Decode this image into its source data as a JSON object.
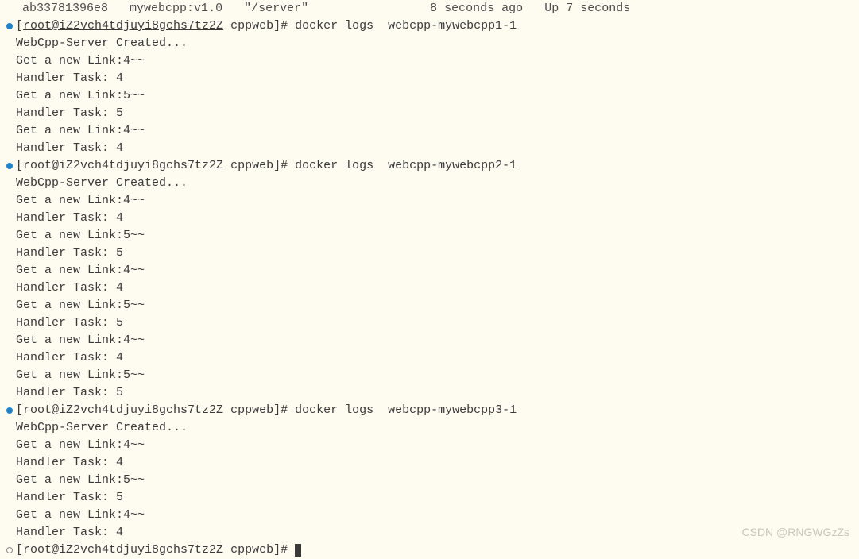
{
  "top_row": {
    "container_id": "ab33781396e8",
    "image": "mywebcpp:v1.0",
    "command": "\"/server\"",
    "created": "8 seconds ago",
    "status": "Up 7 seconds"
  },
  "blocks": [
    {
      "prompt_user_host": "root@iZ2vch4tdjuyi8gchs7tz2Z",
      "prompt_dir": "cppweb",
      "command": "docker logs  webcpp-mywebcpp1-1",
      "underline_host": true,
      "output": [
        "WebCpp-Server Created...",
        "Get a new Link:4~~",
        "Handler Task: 4",
        "Get a new Link:5~~",
        "Handler Task: 5",
        "Get a new Link:4~~",
        "Handler Task: 4"
      ]
    },
    {
      "prompt_user_host": "root@iZ2vch4tdjuyi8gchs7tz2Z",
      "prompt_dir": "cppweb",
      "command": "docker logs  webcpp-mywebcpp2-1",
      "underline_host": false,
      "output": [
        "WebCpp-Server Created...",
        "Get a new Link:4~~",
        "Handler Task: 4",
        "Get a new Link:5~~",
        "Handler Task: 5",
        "Get a new Link:4~~",
        "Handler Task: 4",
        "Get a new Link:5~~",
        "Handler Task: 5",
        "Get a new Link:4~~",
        "Handler Task: 4",
        "Get a new Link:5~~",
        "Handler Task: 5"
      ]
    },
    {
      "prompt_user_host": "root@iZ2vch4tdjuyi8gchs7tz2Z",
      "prompt_dir": "cppweb",
      "command": "docker logs  webcpp-mywebcpp3-1",
      "underline_host": false,
      "output": [
        "WebCpp-Server Created...",
        "Get a new Link:4~~",
        "Handler Task: 4",
        "Get a new Link:5~~",
        "Handler Task: 5",
        "Get a new Link:4~~",
        "Handler Task: 4"
      ]
    }
  ],
  "final_prompt": {
    "prompt_user_host": "root@iZ2vch4tdjuyi8gchs7tz2Z",
    "prompt_dir": "cppweb"
  },
  "watermark": "CSDN @RNGWGzZs"
}
